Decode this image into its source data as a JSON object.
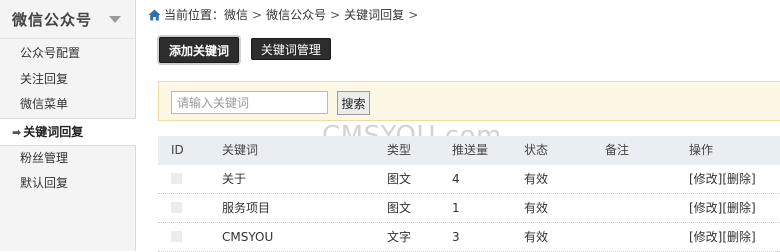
{
  "sidebar": {
    "title": "微信公众号",
    "items": [
      {
        "label": "公众号配置",
        "active": false
      },
      {
        "label": "关注回复",
        "active": false
      },
      {
        "label": "微信菜单",
        "active": false
      },
      {
        "label": "关键词回复",
        "active": true
      },
      {
        "label": "粉丝管理",
        "active": false
      },
      {
        "label": "默认回复",
        "active": false
      }
    ]
  },
  "breadcrumb": {
    "prefix": "当前位置：",
    "crumbs": [
      "微信",
      "微信公众号",
      "关键词回复"
    ],
    "separator": ">"
  },
  "toolbar": {
    "add_label": "添加关键词",
    "manage_label": "关键词管理"
  },
  "search": {
    "placeholder": "请输入关键词",
    "value": "",
    "button_label": "搜索"
  },
  "watermark": "CMSYOU.com",
  "table": {
    "headers": {
      "id": "ID",
      "keyword": "关键词",
      "type": "类型",
      "count": "推送量",
      "status": "状态",
      "note": "备注",
      "ops": "操作"
    },
    "rows": [
      {
        "keyword": "关于",
        "type": "图文",
        "count": "4",
        "status": "有效",
        "note": "",
        "edit": "[修改]",
        "delete": "[删除]"
      },
      {
        "keyword": "服务项目",
        "type": "图文",
        "count": "1",
        "status": "有效",
        "note": "",
        "edit": "[修改]",
        "delete": "[删除]"
      },
      {
        "keyword": "CMSYOU",
        "type": "文字",
        "count": "3",
        "status": "有效",
        "note": "",
        "edit": "[修改]",
        "delete": "[删除]"
      }
    ]
  },
  "colors": {
    "sidebar_bg": "#f4f4f4",
    "button_bg": "#2d2d2d",
    "search_panel_bg": "#fdf8e5",
    "table_header_bg": "#e9eef2"
  }
}
